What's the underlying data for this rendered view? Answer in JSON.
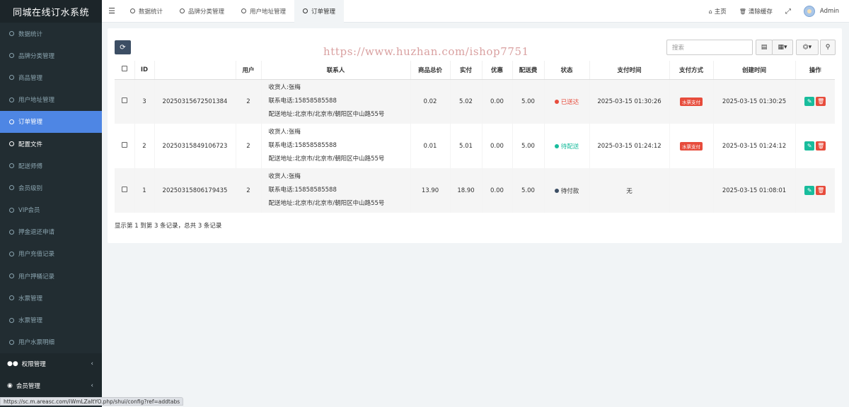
{
  "app": {
    "title": "同城在线订水系统"
  },
  "sidebar": {
    "items": [
      {
        "label": "数据统计",
        "state": "normal"
      },
      {
        "label": "品牌分类管理",
        "state": "normal"
      },
      {
        "label": "商品管理",
        "state": "normal"
      },
      {
        "label": "用户地址管理",
        "state": "normal"
      },
      {
        "label": "订单管理",
        "state": "active"
      },
      {
        "label": "配置文件",
        "state": "bright"
      },
      {
        "label": "配送师傅",
        "state": "normal"
      },
      {
        "label": "会员级别",
        "state": "normal"
      },
      {
        "label": "VIP会员",
        "state": "normal"
      },
      {
        "label": "押金退还申请",
        "state": "normal"
      },
      {
        "label": "用户充值记录",
        "state": "normal"
      },
      {
        "label": "用户押桶记录",
        "state": "normal"
      },
      {
        "label": "水票管理",
        "state": "normal"
      },
      {
        "label": "水票管理",
        "state": "normal"
      },
      {
        "label": "用户水票明细",
        "state": "normal"
      }
    ],
    "groups": [
      {
        "label": "权限管理",
        "icon": "users-icon"
      },
      {
        "label": "会员管理",
        "icon": "user-circle-icon"
      }
    ]
  },
  "topbar": {
    "tabs": [
      {
        "label": "数据统计",
        "active": false
      },
      {
        "label": "品牌分类管理",
        "active": false
      },
      {
        "label": "用户地址管理",
        "active": false
      },
      {
        "label": "订单管理",
        "active": true
      }
    ],
    "home": "主页",
    "clear_cache": "清除缓存",
    "user": "Admin"
  },
  "toolbar": {
    "search_placeholder": "搜索"
  },
  "watermark": "https://www.huzhan.com/ishop7751",
  "table": {
    "headers": [
      "ID",
      "用户",
      "联系人",
      "商品总价",
      "实付",
      "优惠",
      "配送费",
      "状态",
      "支付时间",
      "支付方式",
      "创建时间",
      "操作"
    ],
    "rows": [
      {
        "id": "3",
        "order_no": "20250315672501384",
        "user": "2",
        "contact_name": "收货人:张梅",
        "contact_phone": "联系电话:15858585588",
        "contact_addr": "配送地址:北京市/北京市/朝阳区中山路55号",
        "total": "0.02",
        "paid": "5.02",
        "discount": "0.00",
        "fee": "5.00",
        "status": "已送达",
        "status_color": "#e74c3c",
        "pay_time": "2025-03-15 01:30:26",
        "pay_method": "水票支付",
        "created": "2025-03-15 01:30:25"
      },
      {
        "id": "2",
        "order_no": "20250315849106723",
        "user": "2",
        "contact_name": "收货人:张梅",
        "contact_phone": "联系电话:15858585588",
        "contact_addr": "配送地址:北京市/北京市/朝阳区中山路55号",
        "total": "0.01",
        "paid": "5.01",
        "discount": "0.00",
        "fee": "5.00",
        "status": "待配送",
        "status_color": "#18bc9c",
        "pay_time": "2025-03-15 01:24:12",
        "pay_method": "水票支付",
        "created": "2025-03-15 01:24:12"
      },
      {
        "id": "1",
        "order_no": "20250315806179435",
        "user": "2",
        "contact_name": "收货人:张梅",
        "contact_phone": "联系电话:15858585588",
        "contact_addr": "配送地址:北京市/北京市/朝阳区中山路55号",
        "total": "13.90",
        "paid": "18.90",
        "discount": "0.00",
        "fee": "5.00",
        "status": "待付款",
        "status_color": "#3c4e64",
        "pay_time": "无",
        "pay_method": "",
        "created": "2025-03-15 01:08:01"
      }
    ]
  },
  "pagination": {
    "summary": "显示第 1 到第 3 条记录，总共 3 条记录"
  },
  "statusbar": {
    "url": "https://sc.m.areasc.com/iWmLZaltYO.php/shui/config?ref=addtabs"
  }
}
